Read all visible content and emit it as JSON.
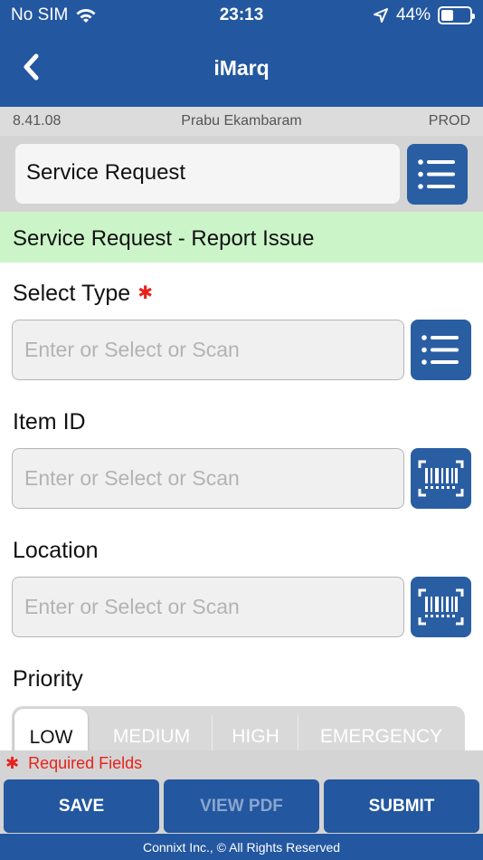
{
  "status_bar": {
    "carrier": "No SIM",
    "time": "23:13",
    "battery_text": "44%",
    "battery_level": 0.44
  },
  "header": {
    "title": "iMarq"
  },
  "info_bar": {
    "version": "8.41.08",
    "user": "Prabu Ekambaram",
    "environment": "PROD"
  },
  "module": {
    "value": "Service Request"
  },
  "section_title": "Service Request - Report Issue",
  "form": {
    "select_type": {
      "label": "Select Type",
      "required_mark": "✱",
      "placeholder": "Enter or Select or Scan"
    },
    "item_id": {
      "label": "Item ID",
      "placeholder": "Enter or Select or Scan"
    },
    "location": {
      "label": "Location",
      "placeholder": "Enter or Select or Scan"
    },
    "priority": {
      "label": "Priority",
      "options": [
        "LOW",
        "MEDIUM",
        "HIGH",
        "EMERGENCY"
      ],
      "selected": "LOW"
    }
  },
  "required_note": {
    "mark": "✱",
    "text": "Required Fields"
  },
  "actions": {
    "save": "SAVE",
    "view_pdf": "VIEW PDF",
    "submit": "SUBMIT"
  },
  "footer": "Connixt Inc., © All Rights Reserved",
  "colors": {
    "primary": "#2357a0",
    "banner": "#cbf5c8",
    "required": "#e8221b"
  }
}
